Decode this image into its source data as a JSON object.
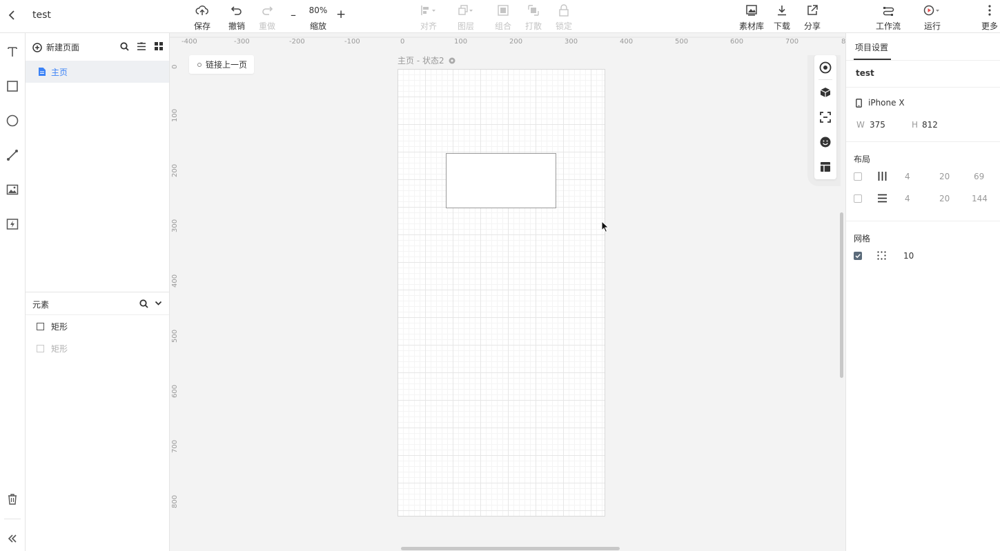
{
  "header": {
    "back_icon": "chevron-left-icon",
    "project_name": "test",
    "save": "保存",
    "undo": "撤销",
    "redo": "重做",
    "zoom_value": "80%",
    "zoom_label": "缩放",
    "zoom_out": "–",
    "zoom_in": "+",
    "align": "对齐",
    "layer": "图层",
    "group": "组合",
    "ungroup": "打散",
    "lock": "锁定",
    "assets": "素材库",
    "download": "下载",
    "share": "分享",
    "workflow": "工作流",
    "run": "运行",
    "more": "更多"
  },
  "pages": {
    "new_page": "新建页面",
    "items": [
      {
        "label": "主页",
        "active": true
      }
    ]
  },
  "elements": {
    "title": "元素",
    "items": [
      {
        "label": "矩形",
        "muted": false
      },
      {
        "label": "矩形",
        "muted": true
      }
    ]
  },
  "canvas": {
    "link_prev": "链接上一页",
    "artboard_title": "主页 - 状态2",
    "ruler_h": [
      "-400",
      "-300",
      "-200",
      "-100",
      "0",
      "100",
      "200",
      "300",
      "400",
      "500",
      "600",
      "700",
      "8"
    ],
    "ruler_v": [
      "0",
      "100",
      "200",
      "300",
      "400",
      "500",
      "600",
      "700",
      "800"
    ]
  },
  "settings": {
    "tab": "项目设置",
    "name": "test",
    "device": "iPhone X",
    "w_label": "W",
    "w_value": "375",
    "h_label": "H",
    "h_value": "812",
    "layout_title": "布局",
    "layout_cols": [
      "4",
      "20",
      "69"
    ],
    "layout_rows": [
      "4",
      "20",
      "144"
    ],
    "grid_title": "网格",
    "grid_value": "10"
  },
  "colors": {
    "accent": "#3b82f6",
    "active_bg": "#eef0f3"
  }
}
